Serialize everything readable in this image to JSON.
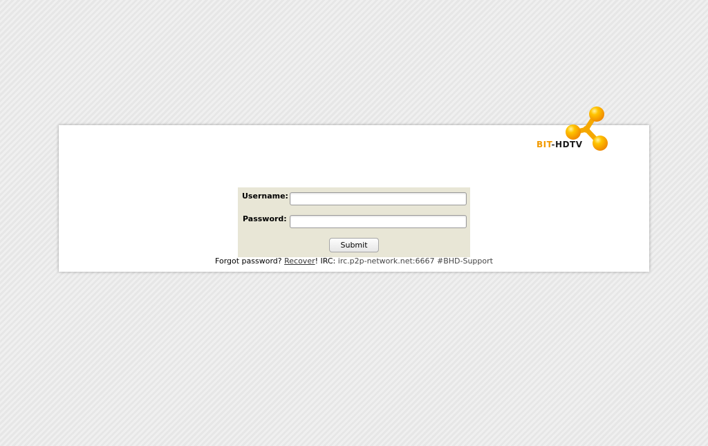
{
  "logo": {
    "bit": "BIT",
    "dash": "-",
    "hdtv": "HDTV",
    "icon": "molecule-logo-icon",
    "colors": {
      "orange": "#f29a00",
      "yellow": "#ffc400"
    }
  },
  "login": {
    "username_label": "Username:",
    "password_label": "Password:",
    "username_value": "",
    "password_value": "",
    "submit_label": "Submit"
  },
  "footer": {
    "forgot_text": "Forgot password?",
    "recover_link": "Recover",
    "exclamation": "!",
    "irc_label": "IRC:",
    "irc_address": "irc.p2p-network.net:6667 #BHD-Support"
  },
  "colors": {
    "form_background": "#e8e6d6",
    "panel_background": "#ffffff",
    "page_background": "#e9e9e9"
  }
}
